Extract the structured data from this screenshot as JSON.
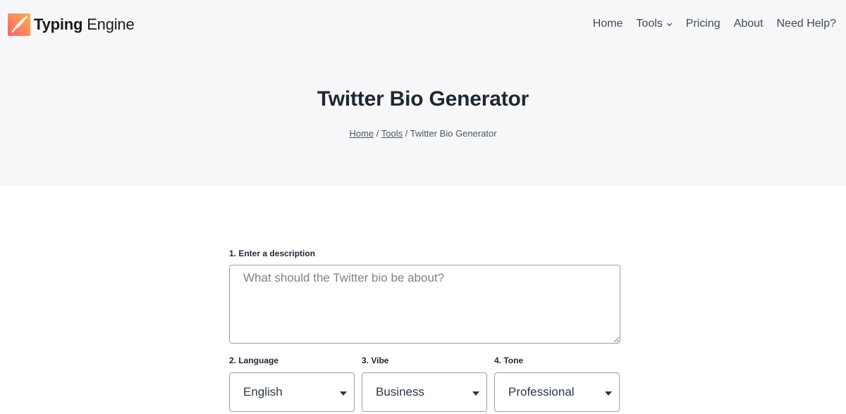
{
  "brand": {
    "name_strong": "Typing",
    "name_light": " Engine",
    "colors": {
      "gradient_start": "#ff5f6d",
      "gradient_end": "#ffb347"
    }
  },
  "nav": {
    "items": [
      {
        "label": "Home"
      },
      {
        "label": "Tools",
        "has_dropdown": true
      },
      {
        "label": "Pricing"
      },
      {
        "label": "About"
      },
      {
        "label": "Need Help?"
      }
    ]
  },
  "hero": {
    "title": "Twitter Bio Generator",
    "breadcrumb": {
      "home": "Home",
      "sep1": " / ",
      "tools": "Tools",
      "sep2": " / ",
      "current": "Twitter Bio Generator"
    }
  },
  "form": {
    "description": {
      "label": "1. Enter a description",
      "value": "",
      "placeholder": "What should the Twitter bio be about?"
    },
    "language": {
      "label": "2. Language",
      "selected": "English"
    },
    "vibe": {
      "label": "3. Vibe",
      "selected": "Business"
    },
    "tone": {
      "label": "4. Tone",
      "selected": "Professional"
    }
  },
  "icons": {
    "logo": "feather-logo-icon",
    "tools_dropdown": "chevron-down-icon",
    "select_caret": "caret-down-icon"
  }
}
